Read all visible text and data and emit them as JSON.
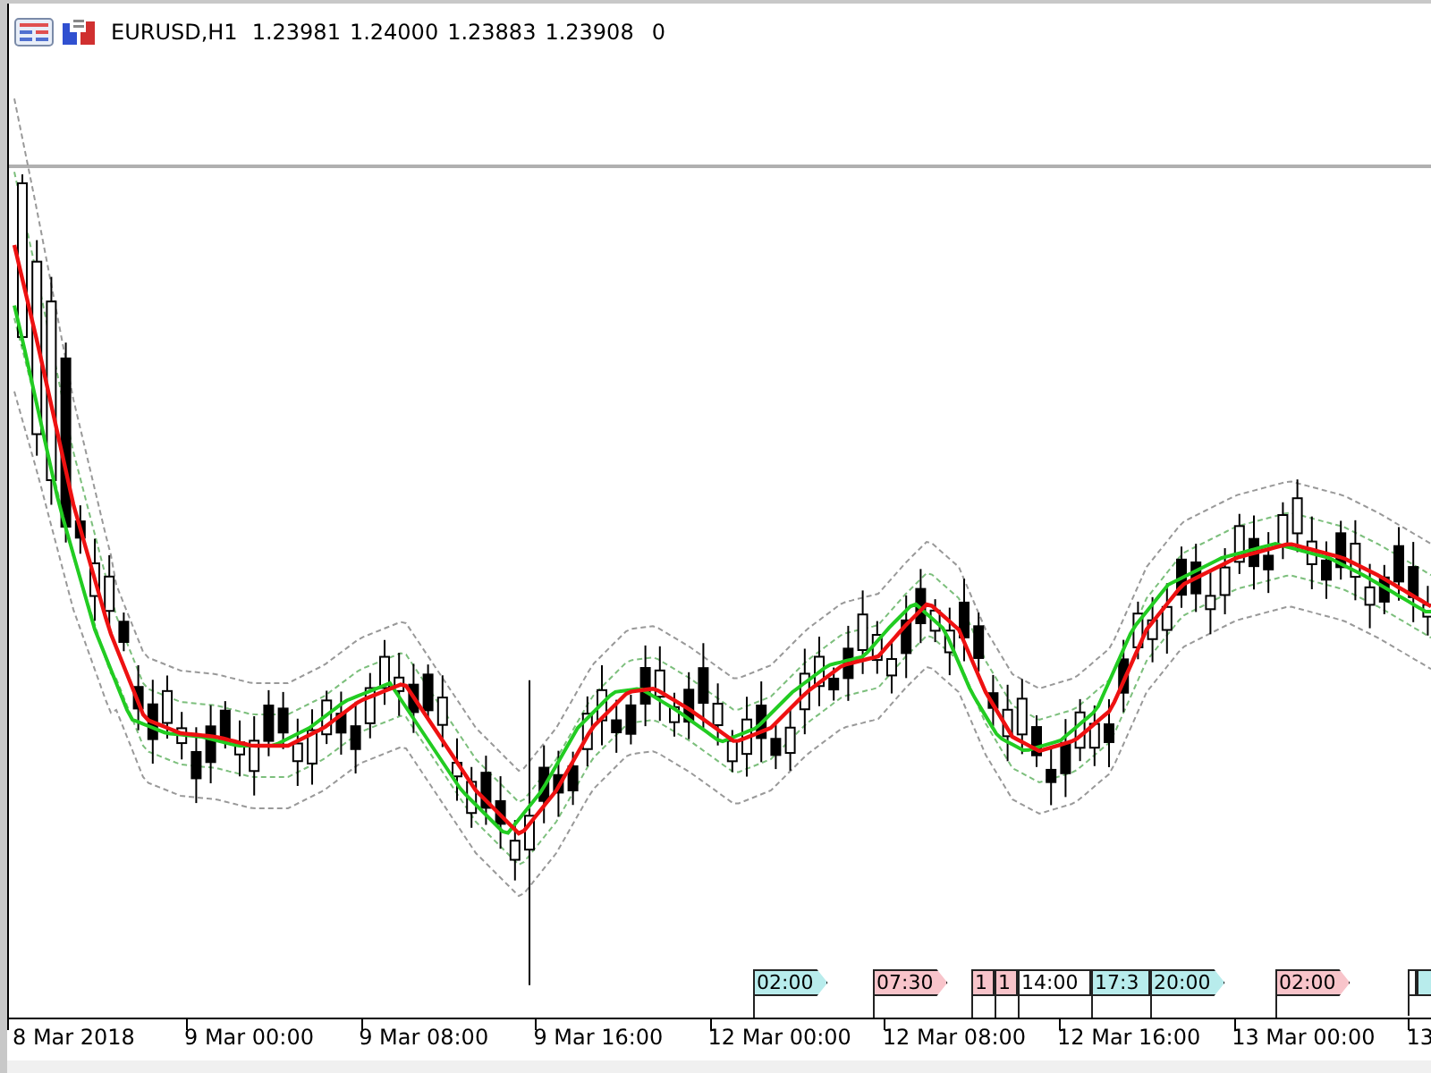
{
  "header": {
    "symbol": "EURUSD,H1",
    "prices": [
      "1.23981",
      "1.24000",
      "1.23883",
      "1.23908"
    ],
    "volume": "0"
  },
  "event_tags": [
    {
      "label": "02:00",
      "color": "#b8ecec"
    },
    {
      "label": "07:30",
      "color": "#f8c4ca"
    },
    {
      "label": "1",
      "color": "#f8c4ca"
    },
    {
      "label": "1",
      "color": "#f8c4ca"
    },
    {
      "label": "14:00",
      "color": "#ffffff"
    },
    {
      "label": "17:3",
      "color": "#b8ecec"
    },
    {
      "label": "20:00",
      "color": "#b8ecec"
    },
    {
      "label": "02:00",
      "color": "#f8c4ca"
    }
  ],
  "time_axis": [
    "8 Mar 2018",
    "9 Mar 00:00",
    "9 Mar 08:00",
    "9 Mar 16:00",
    "12 Mar 00:00",
    "12 Mar 08:00",
    "12 Mar 16:00",
    "13 Mar 00:00",
    "13"
  ]
}
